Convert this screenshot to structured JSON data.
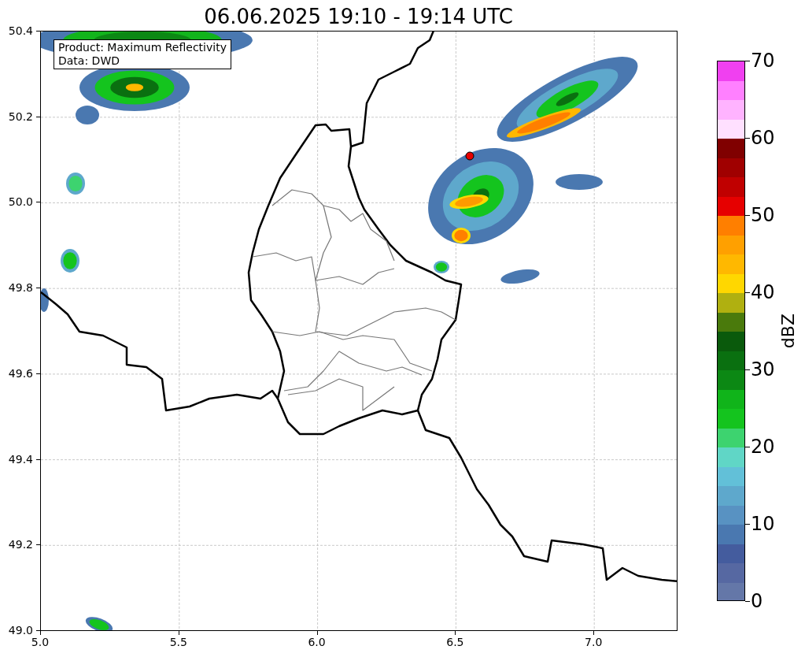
{
  "title": "06.06.2025 19:10 - 19:14 UTC",
  "info_box": [
    "Product: Maximum Reflectivity",
    "Data: DWD"
  ],
  "x_ticks": [
    "5.0",
    "5.5",
    "6.0",
    "6.5",
    "7.0"
  ],
  "y_ticks": [
    "50.4",
    "50.2",
    "50.0",
    "49.8",
    "49.6",
    "49.4",
    "49.2",
    "49.0"
  ],
  "colorbar": {
    "label": "dBZ",
    "ticks": [
      "70",
      "60",
      "50",
      "40",
      "30",
      "20",
      "10",
      "0"
    ],
    "segments": [
      {
        "color": "#f040f0"
      },
      {
        "color": "#ff80ff"
      },
      {
        "color": "#ffb3ff"
      },
      {
        "color": "#ffe0ff"
      },
      {
        "color": "#800000"
      },
      {
        "color": "#a00000"
      },
      {
        "color": "#c00000"
      },
      {
        "color": "#e60000"
      },
      {
        "color": "#ff7f00"
      },
      {
        "color": "#ffa000"
      },
      {
        "color": "#ffb800"
      },
      {
        "color": "#ffd700"
      },
      {
        "color": "#b0b010"
      },
      {
        "color": "#4a7a0c"
      },
      {
        "color": "#0a5a0c"
      },
      {
        "color": "#0a7010"
      },
      {
        "color": "#0c8814"
      },
      {
        "color": "#10b41a"
      },
      {
        "color": "#14c41e"
      },
      {
        "color": "#3dd36f"
      },
      {
        "color": "#60d6c6"
      },
      {
        "color": "#62c0d8"
      },
      {
        "color": "#5ea8cc"
      },
      {
        "color": "#5892c2"
      },
      {
        "color": "#4a78b0"
      },
      {
        "color": "#445c9e"
      },
      {
        "color": "#5668a2"
      },
      {
        "color": "#6477a8"
      }
    ]
  }
}
